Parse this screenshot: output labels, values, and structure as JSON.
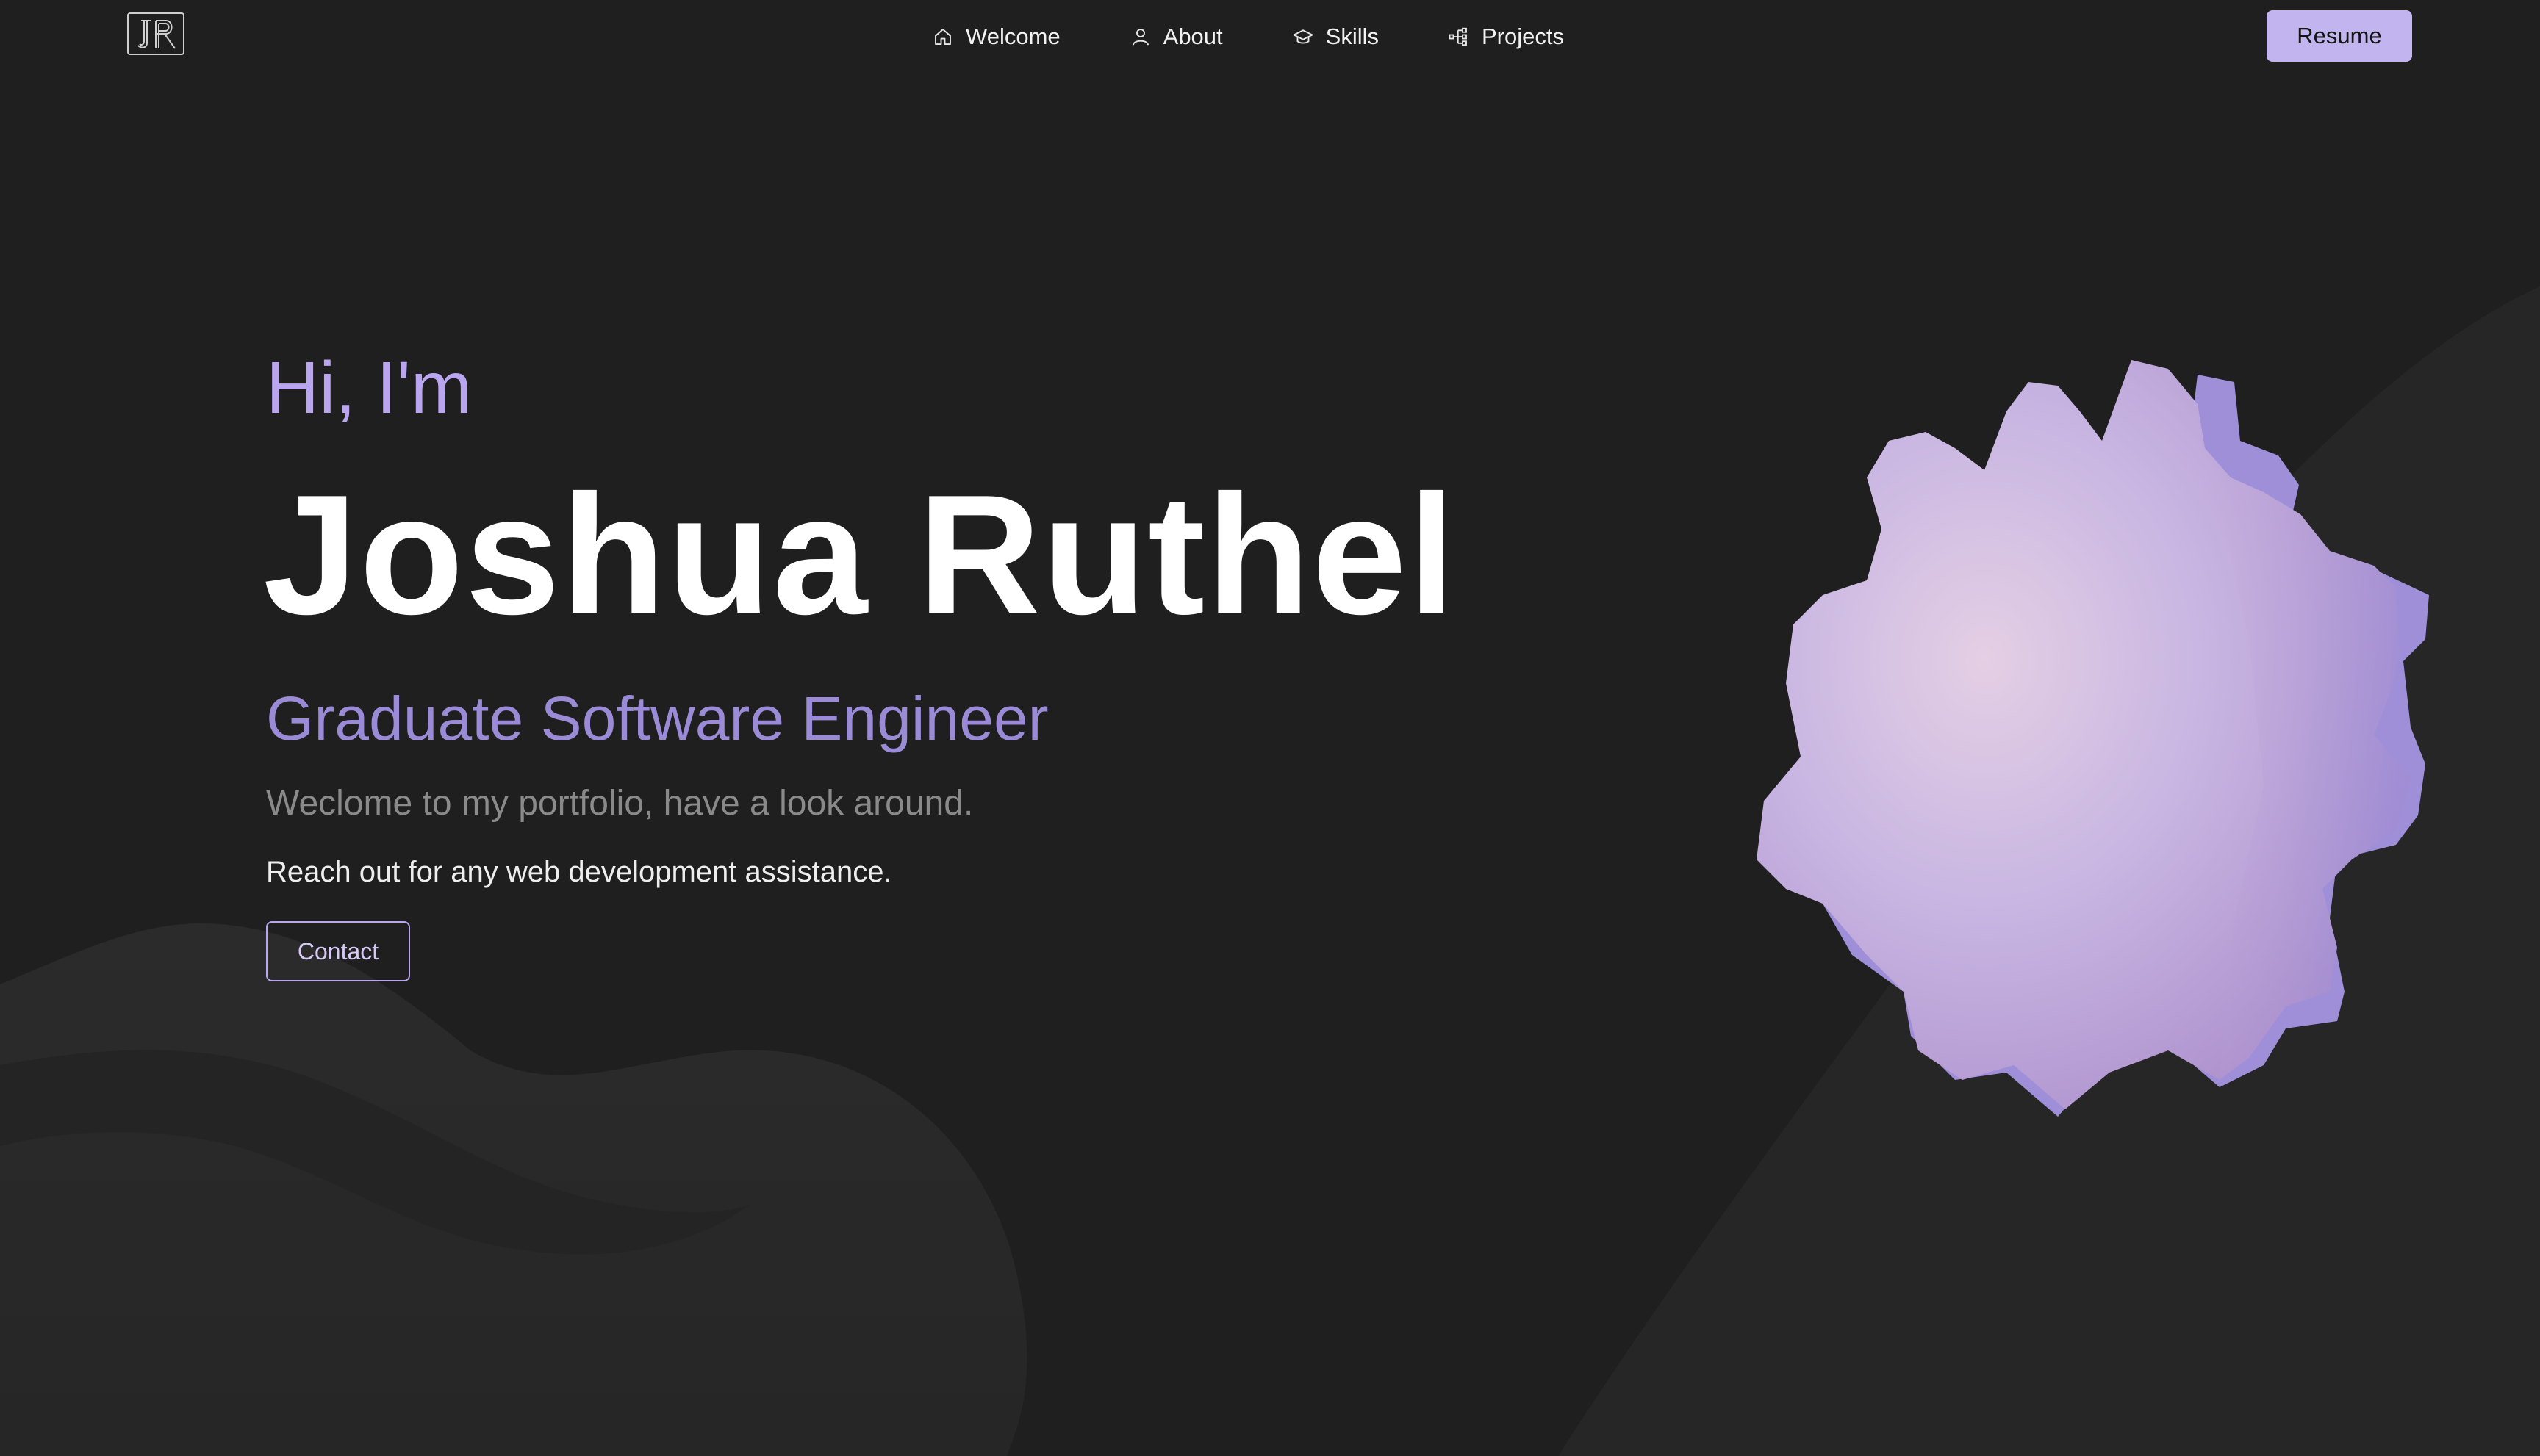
{
  "nav": {
    "logo_text": "JR",
    "items": [
      {
        "label": "Welcome",
        "icon": "home-icon"
      },
      {
        "label": "About",
        "icon": "user-icon"
      },
      {
        "label": "Skills",
        "icon": "graduation-cap-icon"
      },
      {
        "label": "Projects",
        "icon": "sitemap-icon"
      }
    ],
    "resume_label": "Resume"
  },
  "hero": {
    "greeting": "Hi, I'm",
    "name": "Joshua Ruthel",
    "role": "Graduate Software Engineer",
    "welcome": "Weclome to my portfolio, have a look around.",
    "reach_out": "Reach out for any web development assistance.",
    "contact_label": "Contact"
  },
  "colors": {
    "background": "#1f1f1f",
    "accent": "#c2b4ee",
    "accent_text": "#b9a6ee",
    "role_text": "#9b8ad6"
  }
}
